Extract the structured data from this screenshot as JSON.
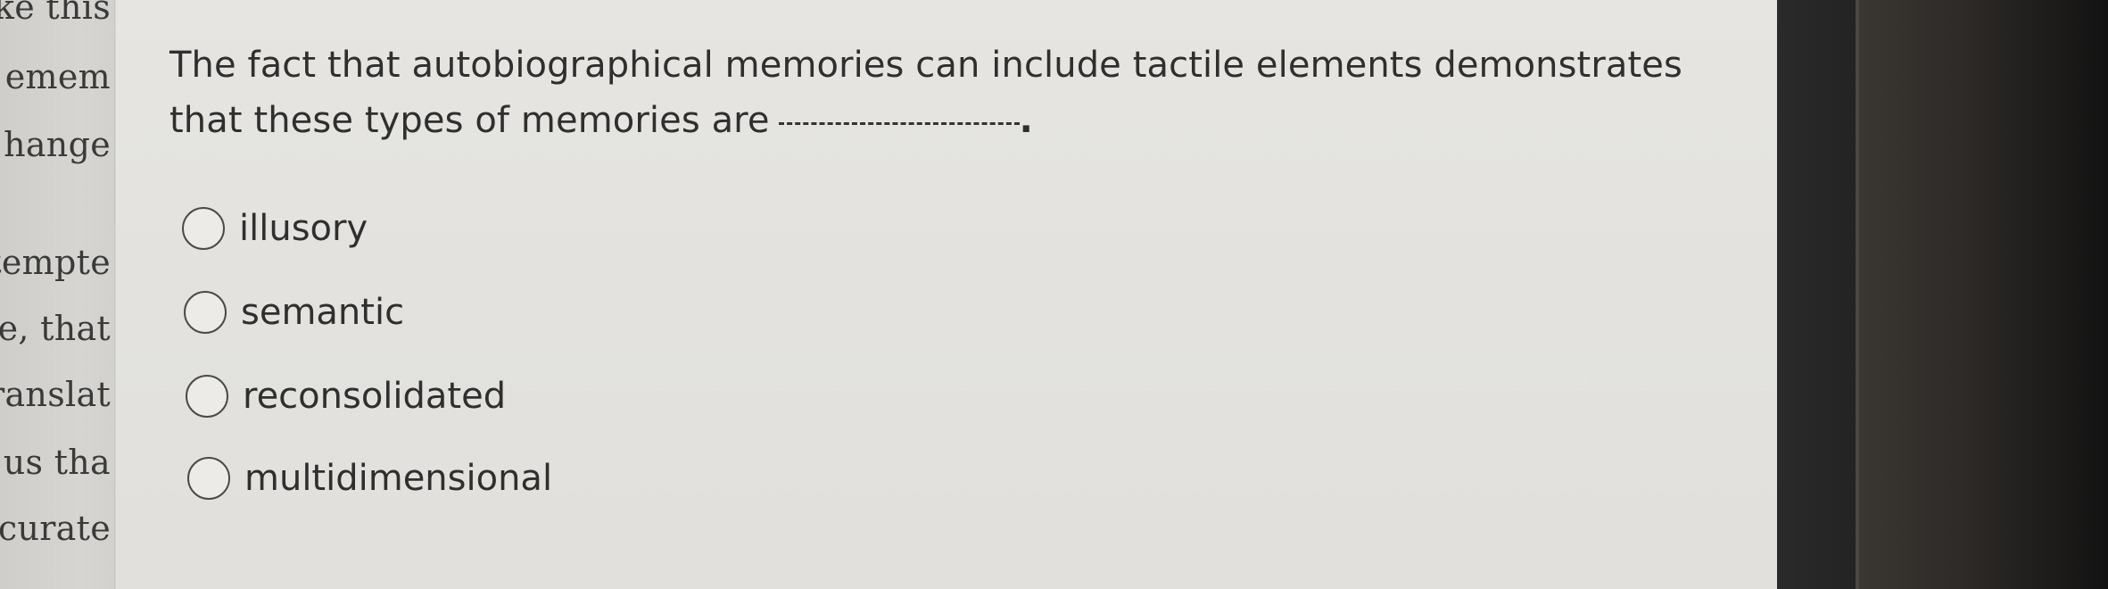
{
  "left_pane": {
    "lines": [
      "ke this",
      "emem",
      "hange",
      "tempte",
      "e, that",
      "ranslat",
      "es us tha",
      "ccurate"
    ]
  },
  "question": {
    "text": "The fact that autobiographical memories can include tactile elements demonstrates that these types of memories are",
    "line1": "The fact that autobiographical memories can include tactile elements demonstrates",
    "line2": "that these types of memories are",
    "blank_end": "."
  },
  "choices": [
    {
      "label": "illusory",
      "selected": false
    },
    {
      "label": "semantic",
      "selected": false
    },
    {
      "label": "reconsolidated",
      "selected": false
    },
    {
      "label": "multidimensional",
      "selected": false
    }
  ]
}
